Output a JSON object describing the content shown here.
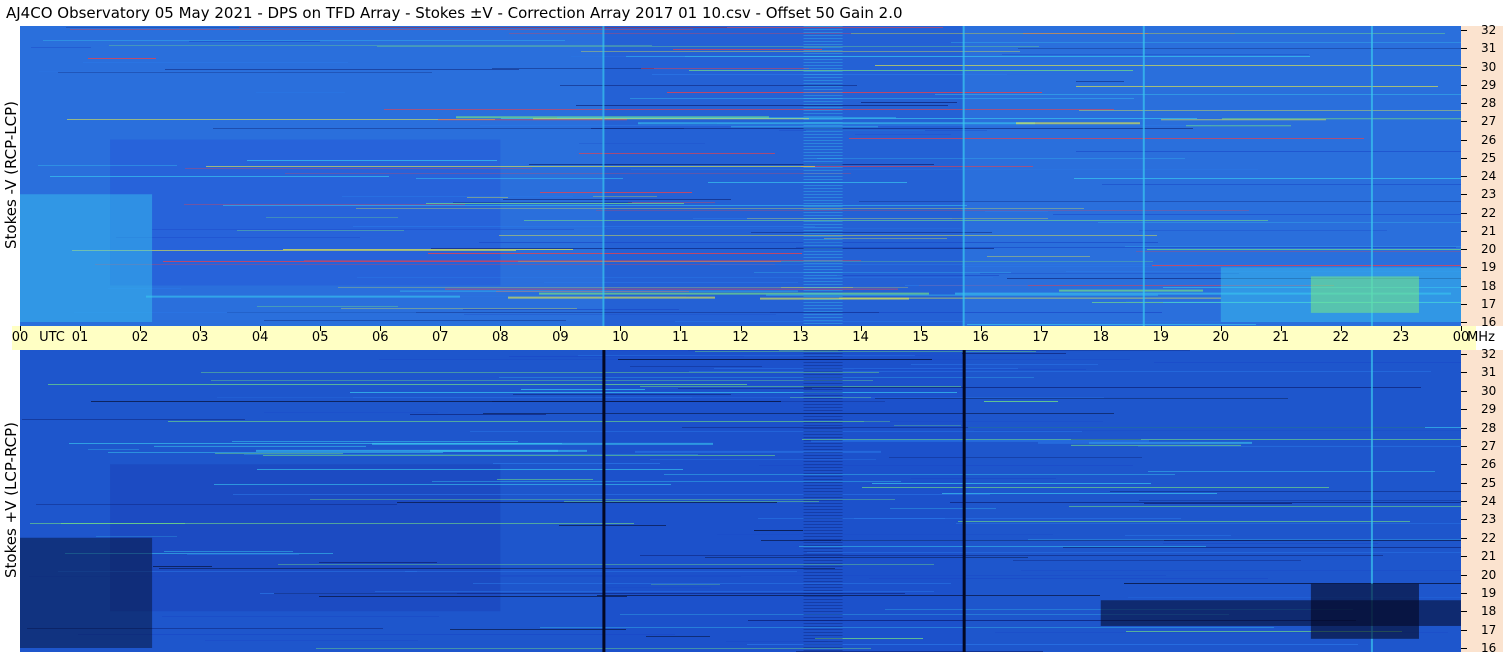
{
  "title": "AJ4CO Observatory  05 May 2021  -  DPS on TFD Array  -  Stokes ±V  -  Correction Array 2017 01 10.csv  -  Offset 50  Gain 2.0",
  "chart_data": [
    {
      "type": "heatmap",
      "name": "top",
      "ylabel": "Stokes -V (RCP-LCP)",
      "x_range_utc_hours": [
        0,
        24
      ],
      "y_range_mhz": [
        16,
        32
      ],
      "y_ticks": [
        "32",
        "31",
        "30",
        "29",
        "28",
        "27",
        "26",
        "25",
        "24",
        "23",
        "22",
        "21",
        "20",
        "19",
        "18",
        "17",
        "16"
      ],
      "colormap": [
        "#0a1a6b",
        "#1a48c8",
        "#2a78e8",
        "#39c8f0",
        "#7ef07a",
        "#f0f040",
        "#ff3c3c"
      ],
      "base_color": "#2a6fdc",
      "vertical_features_utc": [
        9.7,
        15.7,
        18.7,
        22.5
      ],
      "bright_band_mhz": [
        27,
        17.5
      ]
    },
    {
      "type": "heatmap",
      "name": "bottom",
      "ylabel": "Stokes +V (LCP-RCP)",
      "x_range_utc_hours": [
        0,
        24
      ],
      "y_range_mhz": [
        16,
        32
      ],
      "y_ticks": [
        "32",
        "31",
        "30",
        "29",
        "28",
        "27",
        "26",
        "25",
        "24",
        "23",
        "22",
        "21",
        "20",
        "19",
        "18",
        "17",
        "16"
      ],
      "colormap": [
        "#030824",
        "#0a1a6b",
        "#1a48c8",
        "#2a78e8",
        "#39c8f0",
        "#7ef07a"
      ],
      "base_color": "#1e56cc",
      "vertical_features_utc": [
        9.7,
        15.7,
        22.5
      ],
      "bright_band_mhz": [
        27
      ]
    }
  ],
  "time_axis": {
    "labels": [
      "00",
      "UTC",
      "01",
      "02",
      "03",
      "04",
      "05",
      "06",
      "07",
      "08",
      "09",
      "10",
      "11",
      "12",
      "13",
      "14",
      "15",
      "16",
      "17",
      "18",
      "19",
      "20",
      "21",
      "22",
      "23",
      "00",
      "MHz"
    ]
  }
}
